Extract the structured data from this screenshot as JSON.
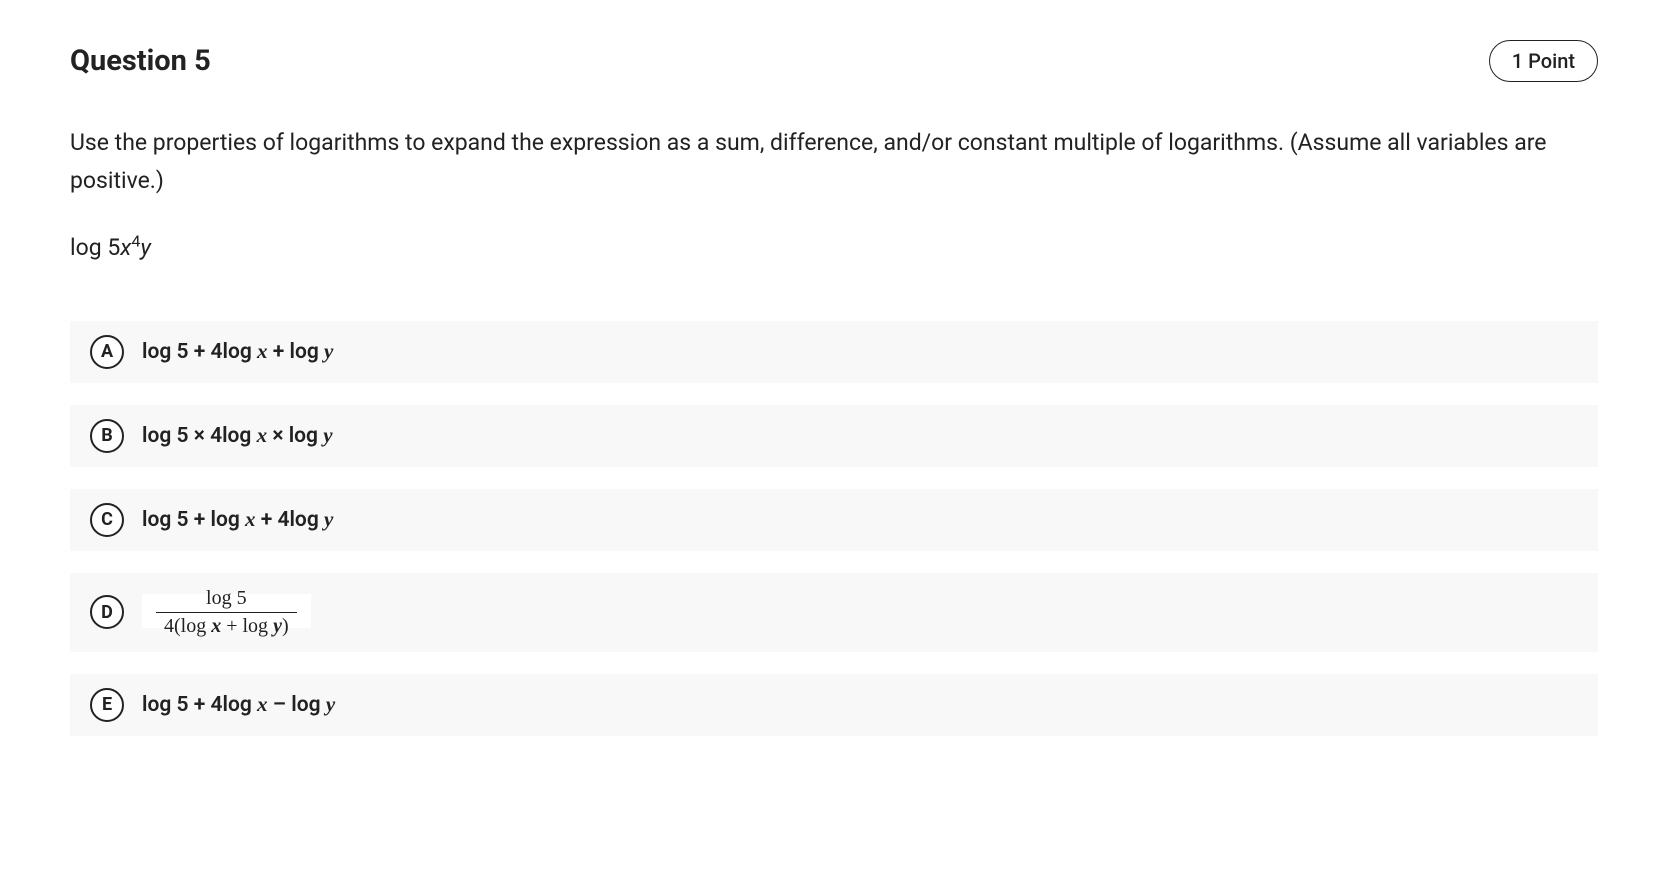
{
  "header": {
    "title": "Question 5",
    "points": "1 Point"
  },
  "prompt": "Use the properties of logarithms to expand the expression as a sum, difference, and/or constant multiple of logarithms. (Assume all variables are positive.)",
  "expression": {
    "prefix": "log 5",
    "var1": "x",
    "exp": "4",
    "var2": "y"
  },
  "options": {
    "A": {
      "letter": "A",
      "pre": "log 5 + 4log ",
      "v1": "x",
      "mid": " + log ",
      "v2": "y"
    },
    "B": {
      "letter": "B",
      "pre": "log 5 × 4log ",
      "v1": "x",
      "mid": " × log ",
      "v2": "y"
    },
    "C": {
      "letter": "C",
      "pre": "log 5 + log ",
      "v1": "x",
      "mid": " + 4log ",
      "v2": "y"
    },
    "D": {
      "letter": "D",
      "num": "log 5",
      "den_pre": "4(log ",
      "den_v1": "x",
      "den_mid": "  +  log ",
      "den_v2": "y",
      "den_post": ")"
    },
    "E": {
      "letter": "E",
      "pre": "log 5 + 4log ",
      "v1": "x",
      "mid": " – log ",
      "v2": "y"
    }
  }
}
